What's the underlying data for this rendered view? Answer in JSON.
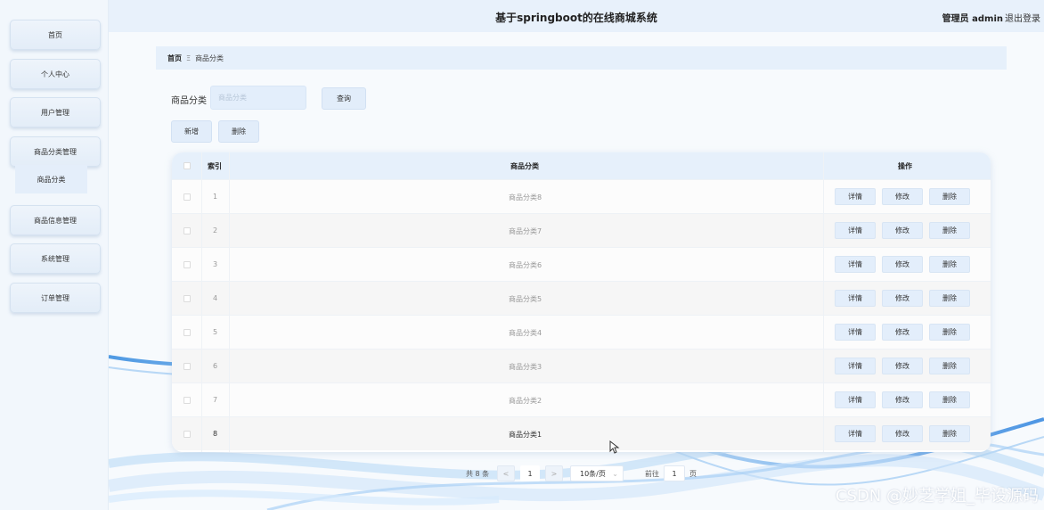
{
  "header": {
    "title": "基于springboot的在线商城系统",
    "user": "管理员 admin",
    "logout": "退出登录"
  },
  "sidebar": {
    "items": [
      {
        "label": "首页"
      },
      {
        "label": "个人中心"
      },
      {
        "label": "用户管理"
      },
      {
        "label": "商品分类管理"
      },
      {
        "label": "商品信息管理"
      },
      {
        "label": "系统管理"
      },
      {
        "label": "订单管理"
      }
    ],
    "submenu_label": "商品分类"
  },
  "breadcrumb": {
    "home": "首页",
    "separator": "Ξ",
    "current": "商品分类"
  },
  "search": {
    "label": "商品分类",
    "placeholder": "商品分类",
    "button": "查询"
  },
  "actions": {
    "add": "新增",
    "delete": "删除"
  },
  "table": {
    "columns": {
      "index": "索引",
      "category": "商品分类",
      "ops": "操作"
    },
    "rows": [
      {
        "index": "1",
        "category": "商品分类8"
      },
      {
        "index": "2",
        "category": "商品分类7"
      },
      {
        "index": "3",
        "category": "商品分类6"
      },
      {
        "index": "4",
        "category": "商品分类5"
      },
      {
        "index": "5",
        "category": "商品分类4"
      },
      {
        "index": "6",
        "category": "商品分类3"
      },
      {
        "index": "7",
        "category": "商品分类2"
      },
      {
        "index": "8",
        "category": "商品分类1"
      }
    ],
    "op_labels": {
      "detail": "详情",
      "edit": "修改",
      "delete": "删除"
    }
  },
  "pagination": {
    "total": "共 8 条",
    "prev": "<",
    "page": "1",
    "next": ">",
    "page_size": "10条/页",
    "goto_label": "前往",
    "goto_value": "1",
    "goto_suffix": "页"
  },
  "watermark": "CSDN @妙芝学姐_毕设源码",
  "colors": {
    "header_bg": "#e8f1fb",
    "button_bg": "#e2edfa",
    "table_head_bg": "#e6f0fb"
  }
}
